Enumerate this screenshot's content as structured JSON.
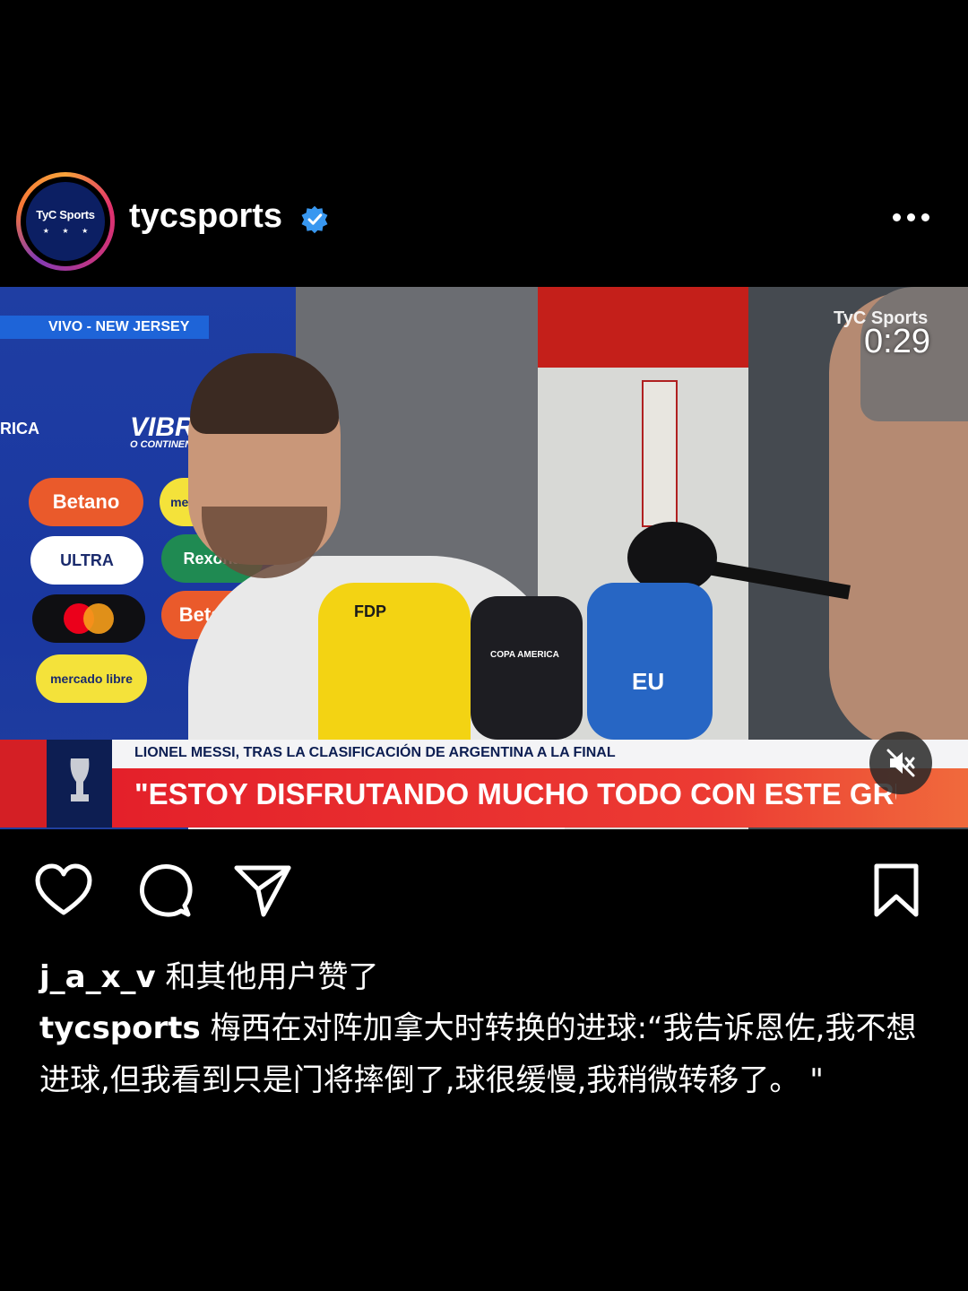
{
  "post": {
    "username": "tycsports",
    "avatar_text": "TyC Sports",
    "avatar_stars": "★ ★ ★",
    "verified": true
  },
  "video": {
    "live_tag": "VIVO - NEW JERSEY",
    "timer": "0:29",
    "watermark": "TyC Sports",
    "sponsors": [
      "Betano",
      "mercado libre",
      "ULTRA",
      "Rexona",
      "Betano",
      "mercado libre",
      "VIBRA",
      "O CONTINENTE",
      "RICA"
    ],
    "mic_labels": [
      "FDP",
      "COPA AMERICA",
      "EU"
    ],
    "lower_third_subtitle": "LIONEL MESSI, TRAS LA CLASIFICACIÓN DE ARGENTINA A LA FINAL",
    "lower_third_quote": "\"ESTOY DISFRUTANDO MUCHO TODO CON ESTE GRUPO"
  },
  "likes": {
    "user": "j_a_x_v",
    "text": "和其他用户赞了"
  },
  "caption": {
    "user": "tycsports",
    "text": "梅西在对阵加拿大时转换的进球:“我告诉恩佐,我不想进球,但我看到只是门将摔倒了,球很缓慢,我稍微转移了。 \""
  },
  "colors": {
    "background": "#000000",
    "verified_blue": "#3897f0",
    "accent_red": "#e4202a",
    "navy": "#0d1e52"
  },
  "icons": [
    "heart-icon",
    "comment-icon",
    "share-icon",
    "bookmark-icon",
    "mute-icon",
    "verified-icon",
    "more-icon"
  ]
}
